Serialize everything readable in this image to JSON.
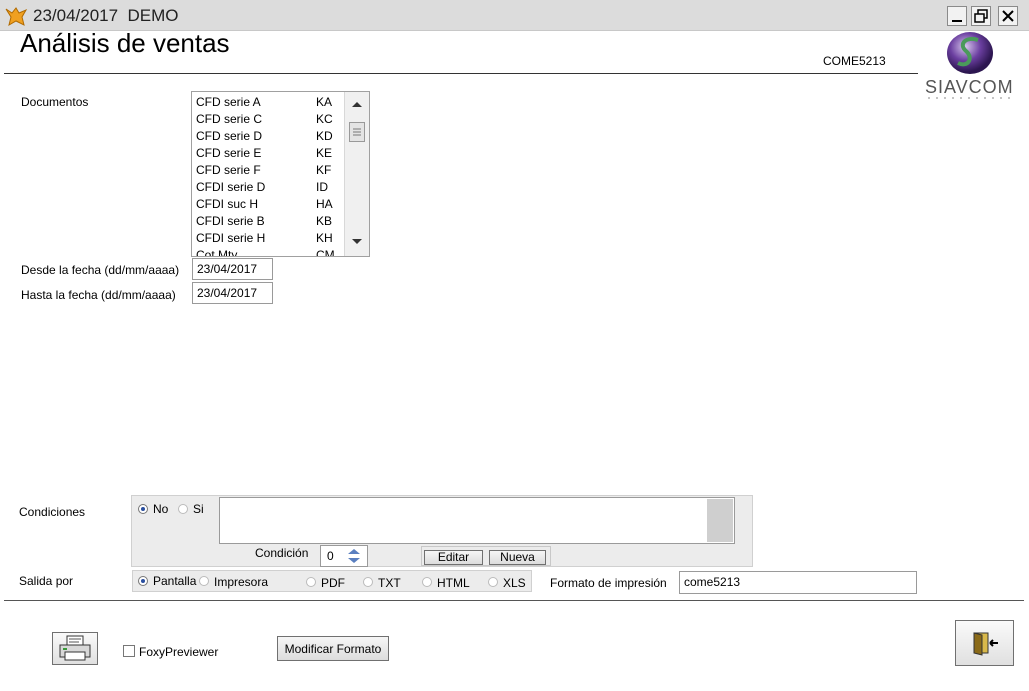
{
  "window": {
    "title": "23/04/2017  DEMO"
  },
  "form": {
    "title": "Análisis de ventas",
    "code": "COME5213",
    "logo_text": "SIAVCOM"
  },
  "documents": {
    "label": "Documentos",
    "items": [
      {
        "name": "CFD serie A",
        "code": "KA"
      },
      {
        "name": "CFD serie C",
        "code": "KC"
      },
      {
        "name": "CFD serie D",
        "code": "KD"
      },
      {
        "name": "CFD serie E",
        "code": "KE"
      },
      {
        "name": "CFD serie F",
        "code": "KF"
      },
      {
        "name": "CFDI  serie D",
        "code": "ID"
      },
      {
        "name": "CFDI  suc  H",
        "code": "HA"
      },
      {
        "name": "CFDI serie B",
        "code": "KB"
      },
      {
        "name": "CFDI serie H",
        "code": "KH"
      },
      {
        "name": "Cot Mty",
        "code": "CM"
      }
    ]
  },
  "dates": {
    "from_label": "Desde la fecha (dd/mm/aaaa)",
    "from_value": "23/04/2017",
    "to_label": "Hasta la fecha (dd/mm/aaaa)",
    "to_value": "23/04/2017"
  },
  "conditions": {
    "label": "Condiciones",
    "no": "No",
    "si": "Si",
    "selected": "No",
    "condition_label": "Condición",
    "condition_value": "0",
    "edit_label": "Editar",
    "new_label": "Nueva"
  },
  "output": {
    "label": "Salida por",
    "options": [
      "Pantalla",
      "Impresora",
      "PDF",
      "TXT",
      "HTML",
      "XLS"
    ],
    "selected": "Pantalla",
    "format_label": "Formato de impresión",
    "format_value": "come5213"
  },
  "footer": {
    "foxy_label": "FoxyPreviewer",
    "foxy_checked": false,
    "modify_label": "Modificar Formato"
  }
}
